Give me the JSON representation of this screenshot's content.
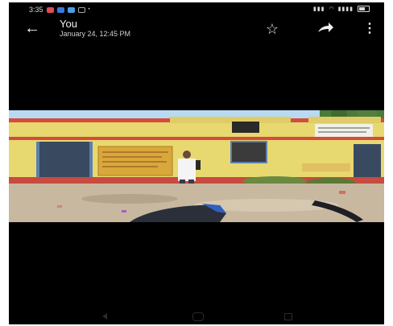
{
  "status_bar": {
    "time": "3:35",
    "icon_colors": [
      "#e24b5a",
      "#3a78e0",
      "#4aa0e8"
    ],
    "right_text": "⁝⁝⁝ ⁞ ᵛᵒˡᵗᵉ ⁵⁶%"
  },
  "app_bar": {
    "title": "You",
    "subtitle": "January 24, 12:45 PM",
    "back_icon": "arrow-left-icon",
    "star_icon": "star-outline-icon",
    "share_icon": "share-arrow-icon",
    "more_icon": "more-vertical-icon"
  },
  "photo": {
    "caption": "",
    "sky_color": "#b8d9f0",
    "wall_color": "#e8d870",
    "trim_color": "#d44c3c",
    "ground_color": "#c8b8a0"
  },
  "nav_bar": {
    "back_icon": "nav-back-icon",
    "home_icon": "nav-home-icon",
    "recents_icon": "nav-recents-icon"
  }
}
